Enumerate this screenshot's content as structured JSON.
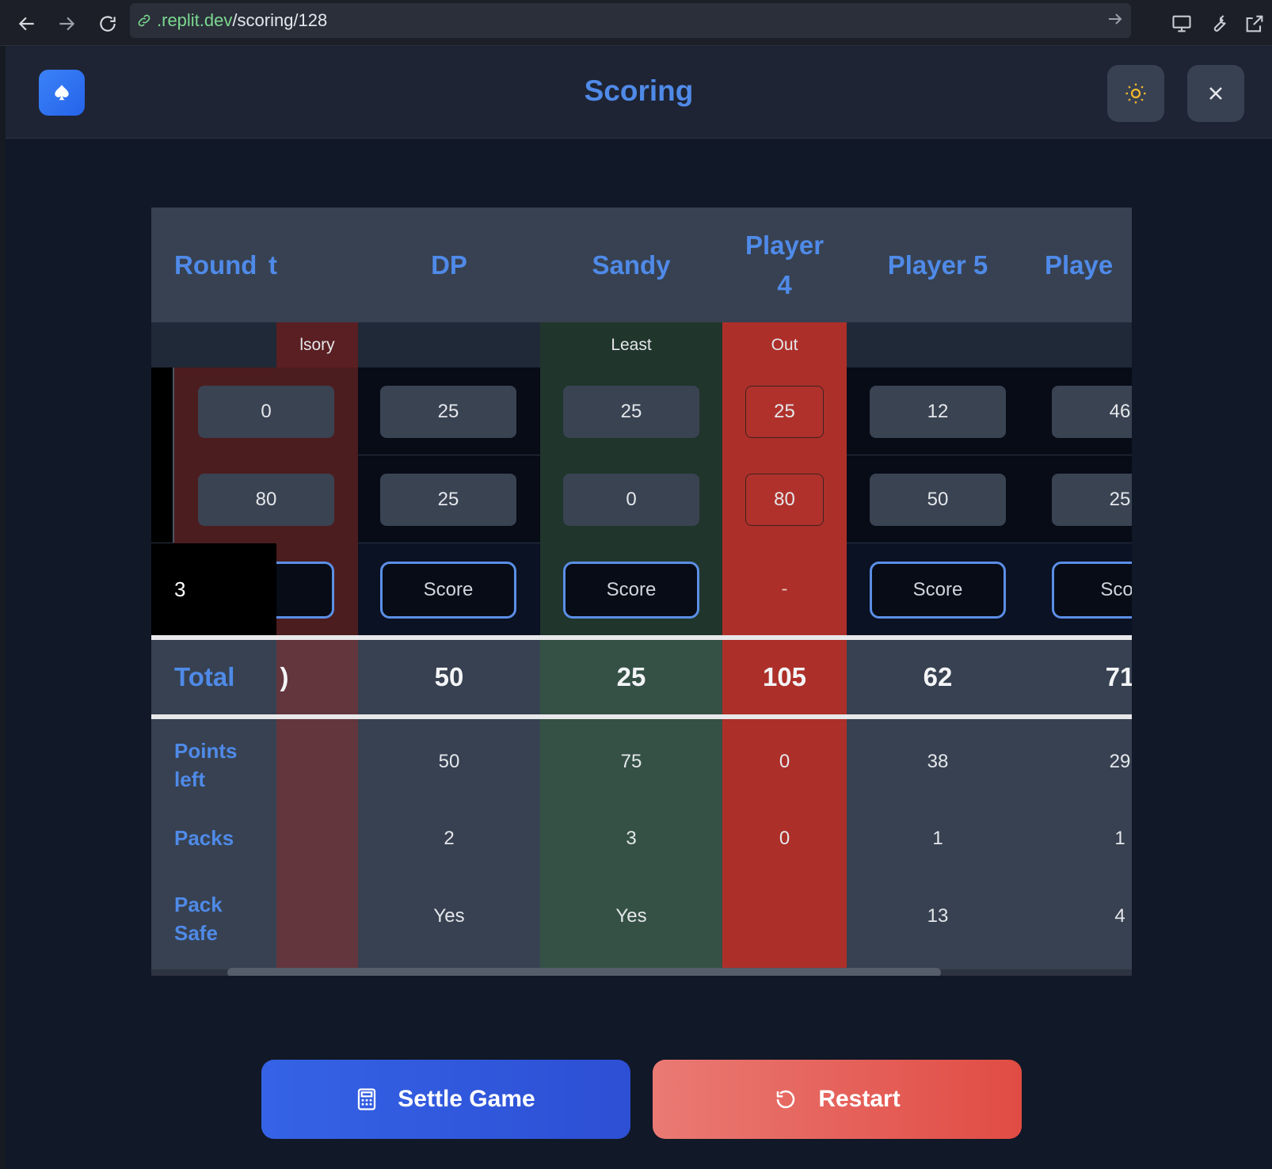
{
  "browser": {
    "url_host": ".replit.dev",
    "url_path": "/scoring/128"
  },
  "app": {
    "title": "Scoring"
  },
  "table": {
    "round_header": "Round",
    "players": [
      {
        "name": "t",
        "status": "lsory",
        "round1": "0",
        "round2": "80",
        "round3": "re",
        "total": ")",
        "points_left": "",
        "packs": "",
        "pack_safe": ""
      },
      {
        "name": "DP",
        "status": "",
        "round1": "25",
        "round2": "25",
        "round3": "Score",
        "total": "50",
        "points_left": "50",
        "packs": "2",
        "pack_safe": "Yes"
      },
      {
        "name": "Sandy",
        "status": "Least",
        "round1": "25",
        "round2": "0",
        "round3": "Score",
        "total": "25",
        "points_left": "75",
        "packs": "3",
        "pack_safe": "Yes"
      },
      {
        "name": "Player\n4",
        "status": "Out",
        "round1": "25",
        "round2": "80",
        "round3": "-",
        "total": "105",
        "points_left": "0",
        "packs": "0",
        "pack_safe": ""
      },
      {
        "name": "Player 5",
        "status": "",
        "round1": "12",
        "round2": "50",
        "round3": "Score",
        "total": "62",
        "points_left": "38",
        "packs": "1",
        "pack_safe": "13"
      },
      {
        "name": "Playe",
        "status": "",
        "round1": "46",
        "round2": "25",
        "round3": "Scor",
        "total": "71",
        "points_left": "29",
        "packs": "1",
        "pack_safe": "4"
      }
    ],
    "current_round": "3",
    "total_label": "Total",
    "points_left_label": "Points left",
    "packs_label": "Packs",
    "pack_safe_label": "Pack Safe"
  },
  "actions": {
    "settle_label": "Settle Game",
    "restart_label": "Restart"
  },
  "colors": {
    "accent": "#4f8ae8",
    "least": "#355146",
    "out": "#ad2f29",
    "compulsory": "#63363d"
  }
}
